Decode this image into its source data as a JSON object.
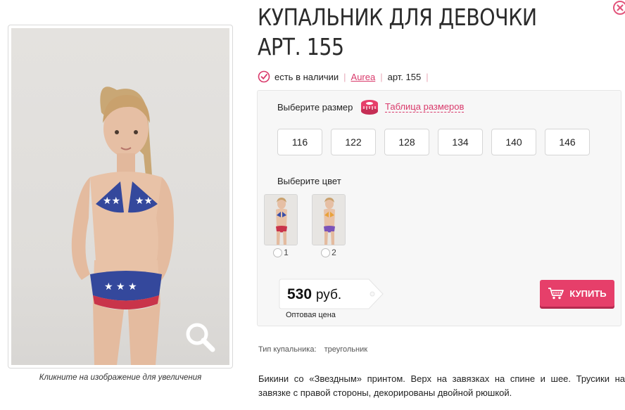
{
  "product": {
    "title": "КУПАЛЬНИК ДЛЯ ДЕВОЧКИ АРТ. 155",
    "availability": "есть в наличии",
    "brand": "Aurea",
    "article": "арт. 155"
  },
  "photo": {
    "caption": "Кликните на изображение для увеличения"
  },
  "size": {
    "label": "Выберите размер",
    "table_link": "Таблица размеров",
    "options": [
      "116",
      "122",
      "128",
      "134",
      "140",
      "146"
    ]
  },
  "color": {
    "label": "Выберите цвет",
    "options": [
      {
        "label": "1",
        "top": "#3a4fa8",
        "bottom": "#c9344a"
      },
      {
        "label": "2",
        "top": "#e9a23a",
        "bottom": "#7b53b8"
      }
    ]
  },
  "price": {
    "amount": "530",
    "currency": "руб.",
    "note": "Оптовая цена"
  },
  "buy_button": "КУПИТЬ",
  "specs": {
    "type_label": "Тип купальника:",
    "type_value": "треугольник"
  },
  "description": "Бикини со «Звездным» принтом. Верх на завязках на спине и шее. Трусики на завязке с правой стороны, декорированы двойной рюшкой.",
  "colors": {
    "accent": "#e63f6a",
    "link": "#d93a6b",
    "panel_bg": "#f7f7f7"
  }
}
